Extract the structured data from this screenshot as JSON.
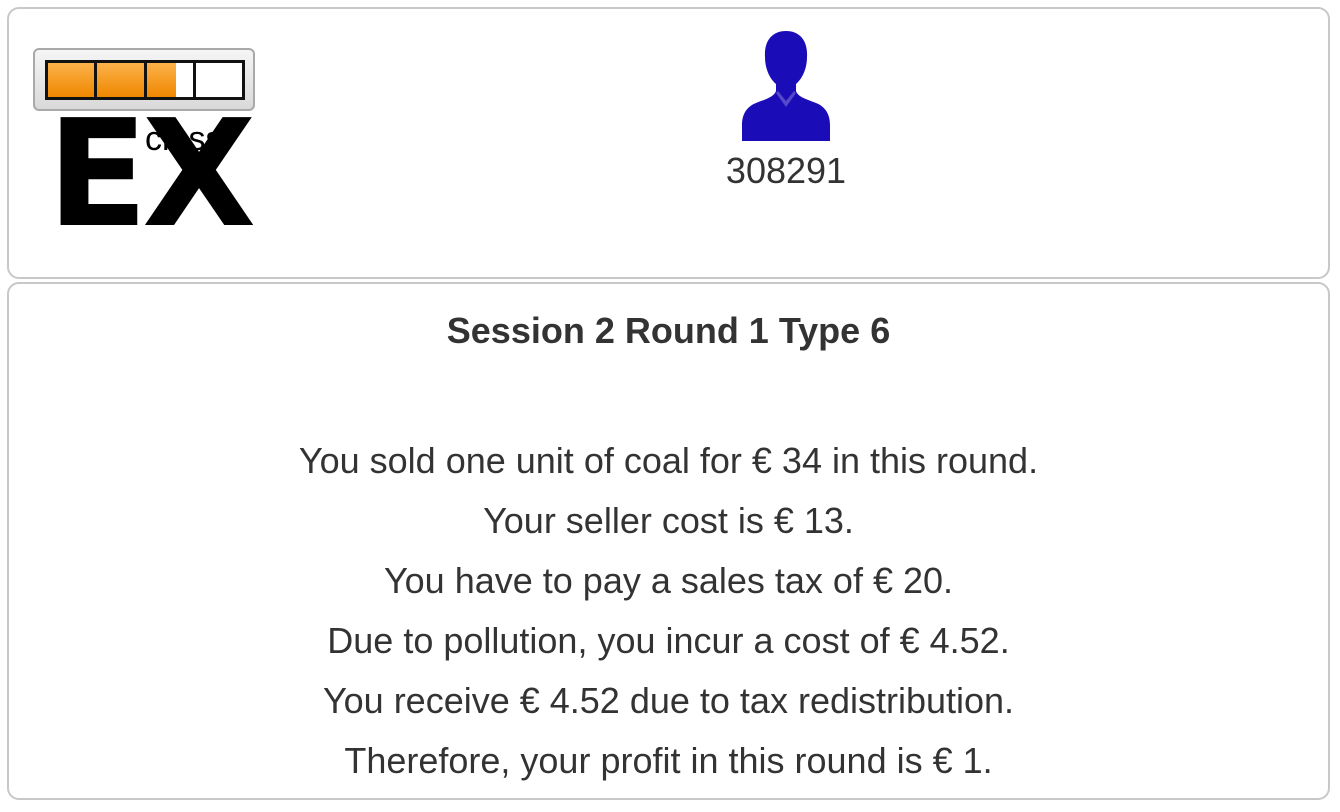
{
  "header": {
    "progress": {
      "fraction": 0.66,
      "segments": 4
    },
    "logo": {
      "big_text": "EX",
      "small_text": "class"
    },
    "user": {
      "icon": "user-icon",
      "id": "308291",
      "icon_color": "#1a0db8"
    }
  },
  "content": {
    "title": "Session 2 Round 1 Type 6",
    "messages": [
      "You sold one unit of coal for € 34 in this round.",
      "Your seller cost is € 13.",
      "You have to pay a sales tax of € 20.",
      "Due to pollution, you incur a cost of € 4.52.",
      "You receive € 4.52 due to tax redistribution.",
      "Therefore, your profit in this round is € 1."
    ]
  },
  "colors": {
    "progress_fill": "#f08700",
    "text": "#333333",
    "panel_border": "#c8c8c8"
  }
}
